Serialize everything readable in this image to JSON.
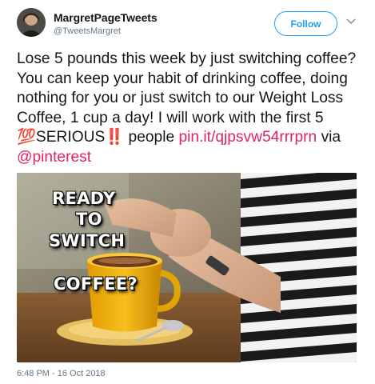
{
  "user": {
    "display_name": "MargretPageTweets",
    "handle": "@TweetsMargret"
  },
  "follow_button": {
    "label": "Follow"
  },
  "tweet": {
    "text_part1": "Lose 5 pounds this week by just switching coffee?  You can keep your habit of drinking coffee, doing nothing for you or just switch to our Weight Loss Coffee, 1 cup a day! I will work with the first 5 ",
    "emoji_hundred": "💯",
    "text_part2": "SERIOUS",
    "emoji_bang": "‼️",
    "text_part3": " people ",
    "link": "pin.it/qjpsvw54rrrprn",
    "text_via": " via ",
    "mention": "@pinterest"
  },
  "media": {
    "overlay_line1": "READY",
    "overlay_line2": "TO",
    "overlay_line3": "SWITCH",
    "overlay_line4": "COFFEE?"
  },
  "timestamp": "6:48 PM - 16 Oct 2018",
  "colors": {
    "accent_blue": "#1da1f2",
    "link_pink": "#e0245e",
    "muted": "#657786",
    "mug_yellow": "#f4b400"
  },
  "icons": {
    "avatar": "user-avatar",
    "menu": "chevron-down-icon"
  }
}
